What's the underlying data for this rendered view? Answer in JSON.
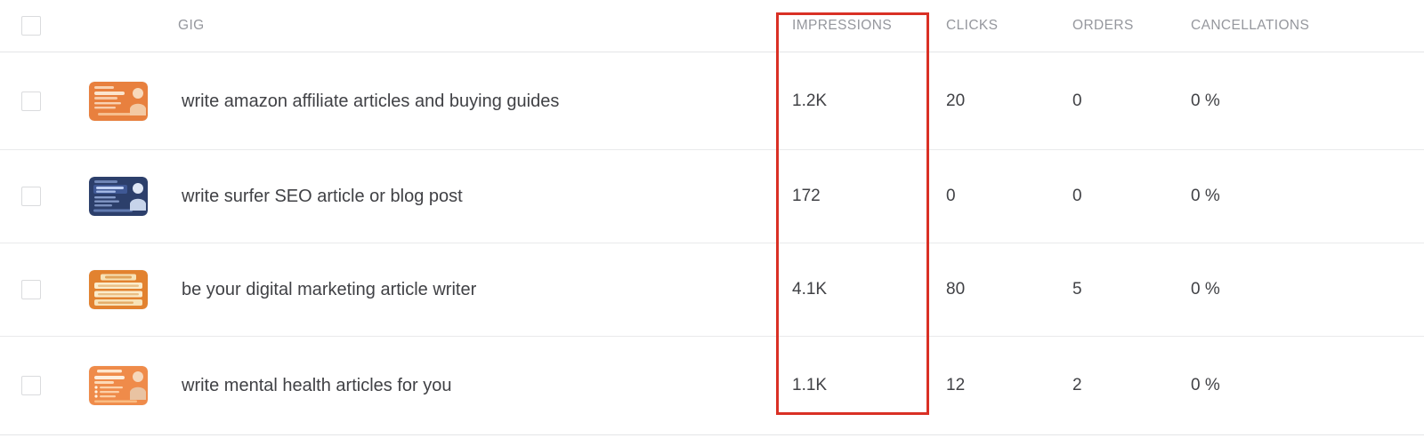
{
  "table": {
    "columns": [
      {
        "key": "gig",
        "label": "GIG"
      },
      {
        "key": "impressions",
        "label": "IMPRESSIONS"
      },
      {
        "key": "clicks",
        "label": "CLICKS"
      },
      {
        "key": "orders",
        "label": "ORDERS"
      },
      {
        "key": "cancellations",
        "label": "CANCELLATIONS"
      }
    ],
    "select_all_checkbox": {
      "checked": false
    },
    "rows": [
      {
        "title": "write amazon affiliate articles and buying guides",
        "impressions": "1.2K",
        "clicks": "20",
        "orders": "0",
        "cancellations": "0 %",
        "thumbnail": {
          "name": "gig-thumbnail-amazon-affiliate",
          "base_color": "#e8803e",
          "accent_color": "#f4a673",
          "style": "orange-photo-card"
        },
        "checkbox": {
          "checked": false
        }
      },
      {
        "title": "write surfer SEO article or blog post",
        "impressions": "172",
        "clicks": "0",
        "orders": "0",
        "cancellations": "0 %",
        "thumbnail": {
          "name": "gig-thumbnail-surfer-seo",
          "base_color": "#2c3f6b",
          "accent_color": "#4d6aa8",
          "style": "navy-photo-card"
        },
        "checkbox": {
          "checked": false
        }
      },
      {
        "title": "be your digital marketing article writer",
        "impressions": "4.1K",
        "clicks": "80",
        "orders": "5",
        "cancellations": "0 %",
        "thumbnail": {
          "name": "gig-thumbnail-digital-marketing",
          "base_color": "#e2822f",
          "accent_color": "#f6d9a4",
          "style": "orange-bars-card"
        },
        "checkbox": {
          "checked": false
        }
      },
      {
        "title": "write mental health articles for you",
        "impressions": "1.1K",
        "clicks": "12",
        "orders": "2",
        "cancellations": "0 %",
        "thumbnail": {
          "name": "gig-thumbnail-mental-health",
          "base_color": "#ef8b4a",
          "accent_color": "#fbc48d",
          "style": "orange-photo-card"
        },
        "checkbox": {
          "checked": false
        }
      }
    ]
  },
  "annotation": {
    "highlight_color": "#d93025",
    "highlighted_column": "IMPRESSIONS"
  }
}
